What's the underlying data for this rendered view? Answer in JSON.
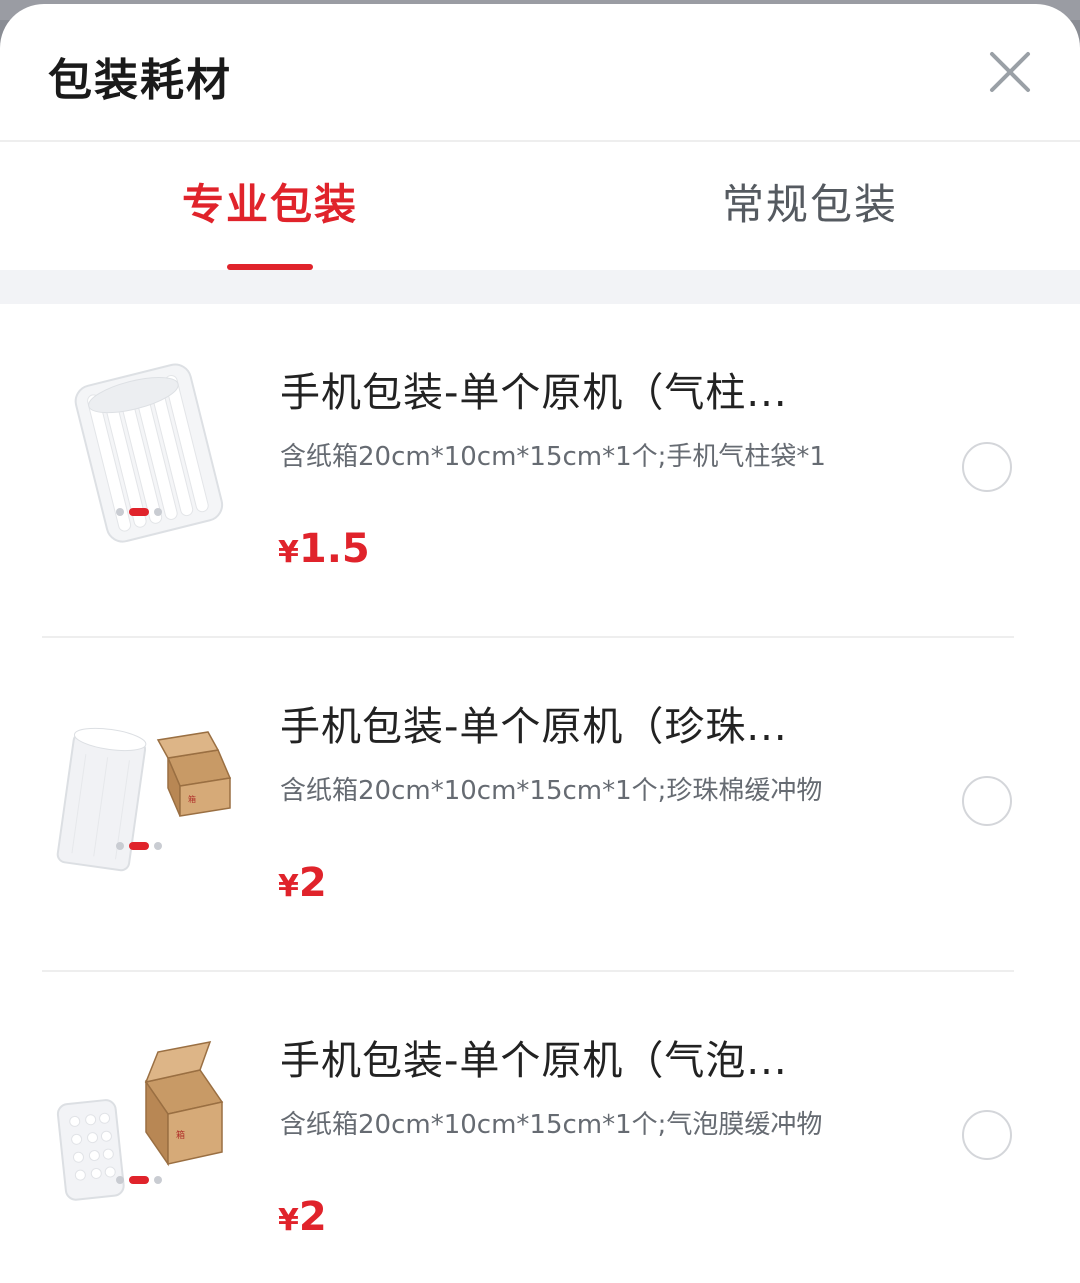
{
  "sheet": {
    "title": "包装耗材",
    "close_icon": "close-icon"
  },
  "tabs": [
    {
      "label": "专业包装",
      "active": true
    },
    {
      "label": "常规包装",
      "active": false
    }
  ],
  "colors": {
    "accent": "#e0232b",
    "text_primary": "#222222",
    "text_secondary": "#666b72",
    "divider": "#eeeeee"
  },
  "items": [
    {
      "title": "手机包装-单个原机（气柱...",
      "desc": "含纸箱20cm*10cm*15cm*1个;手机气柱袋*1",
      "currency": "¥",
      "price": "1.5",
      "selected": false,
      "image_icon": "air-column-bag-image"
    },
    {
      "title": "手机包装-单个原机（珍珠...",
      "desc": "含纸箱20cm*10cm*15cm*1个;珍珠棉缓冲物",
      "currency": "¥",
      "price": "2",
      "selected": false,
      "image_icon": "pearl-foam-and-box-image"
    },
    {
      "title": "手机包装-单个原机（气泡...",
      "desc": "含纸箱20cm*10cm*15cm*1个;气泡膜缓冲物",
      "currency": "¥",
      "price": "2",
      "selected": false,
      "image_icon": "bubble-wrap-and-box-image"
    }
  ]
}
